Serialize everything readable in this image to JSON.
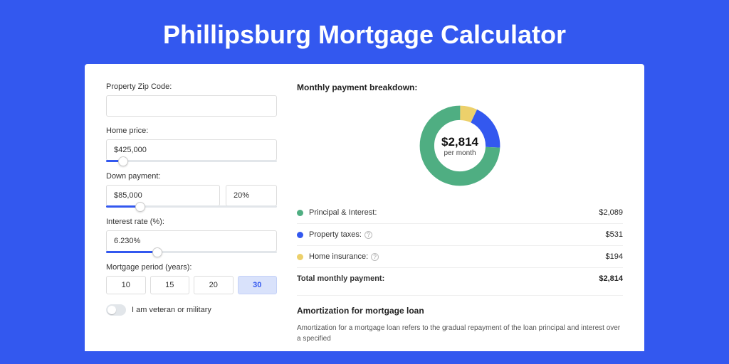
{
  "title": "Phillipsburg Mortgage Calculator",
  "form": {
    "zip_label": "Property Zip Code:",
    "zip_value": "",
    "home_price_label": "Home price:",
    "home_price_value": "$425,000",
    "home_price_slider_pct": 10,
    "down_payment_label": "Down payment:",
    "down_payment_value": "$85,000",
    "down_payment_pct_value": "20%",
    "down_payment_slider_pct": 20,
    "interest_label": "Interest rate (%):",
    "interest_value": "6.230%",
    "interest_slider_pct": 30,
    "period_label": "Mortgage period (years):",
    "periods": [
      "10",
      "15",
      "20",
      "30"
    ],
    "period_active_index": 3,
    "veteran_label": "I am veteran or military"
  },
  "breakdown": {
    "title": "Monthly payment breakdown:",
    "center_amount": "$2,814",
    "center_sub": "per month",
    "rows": [
      {
        "label": "Principal & Interest:",
        "value": "$2,089",
        "color": "#4fae82",
        "help": false
      },
      {
        "label": "Property taxes:",
        "value": "$531",
        "color": "#3358ef",
        "help": true
      },
      {
        "label": "Home insurance:",
        "value": "$194",
        "color": "#ecd06b",
        "help": true
      }
    ],
    "total_label": "Total monthly payment:",
    "total_value": "$2,814"
  },
  "chart_data": {
    "type": "pie",
    "title": "Monthly payment breakdown",
    "series": [
      {
        "name": "Principal & Interest",
        "value": 2089,
        "color": "#4fae82"
      },
      {
        "name": "Property taxes",
        "value": 531,
        "color": "#3358ef"
      },
      {
        "name": "Home insurance",
        "value": 194,
        "color": "#ecd06b"
      }
    ],
    "total": 2814,
    "unit": "USD per month"
  },
  "amortization": {
    "title": "Amortization for mortgage loan",
    "text": "Amortization for a mortgage loan refers to the gradual repayment of the loan principal and interest over a specified"
  }
}
